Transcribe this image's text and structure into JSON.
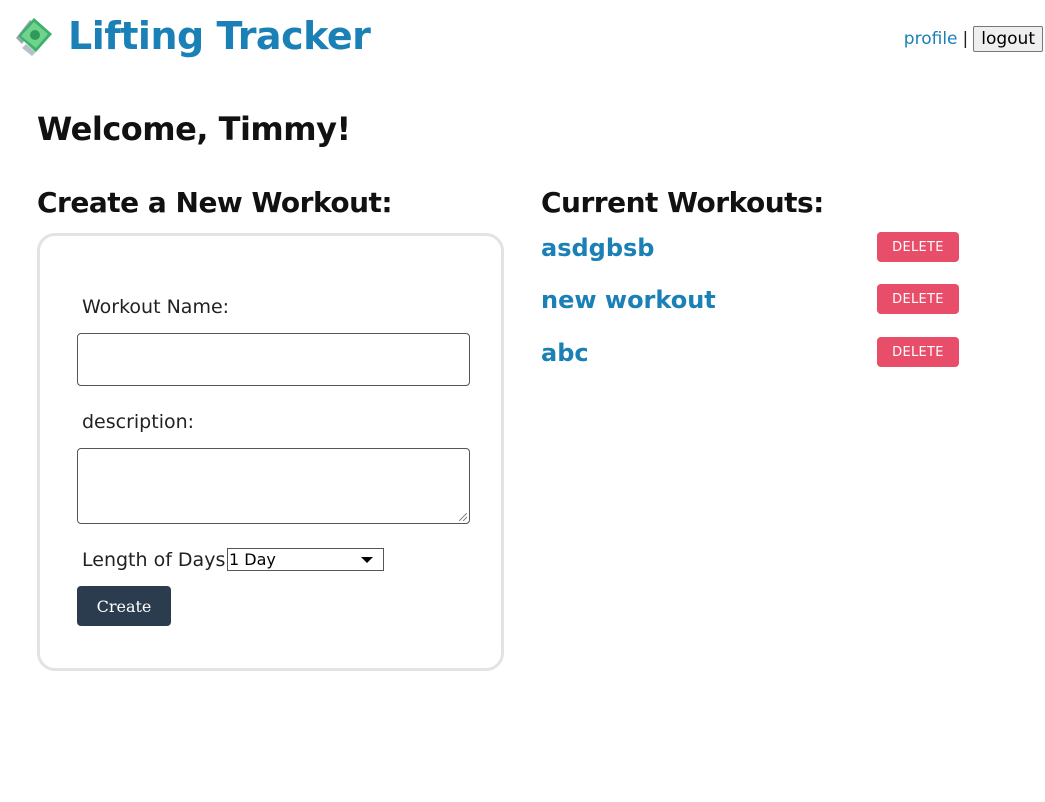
{
  "header": {
    "title": "Lifting Tracker",
    "logo_icon": "dollar-bill-icon",
    "profile_link": "profile",
    "separator": "|",
    "logout_label": "logout"
  },
  "welcome": "Welcome, Timmy!",
  "create_form": {
    "title": "Create a New Workout:",
    "name_label": "Workout Name:",
    "name_value": "",
    "description_label": "description:",
    "description_value": "",
    "days_label": "Length of Days",
    "days_selected": "1 Day",
    "submit_label": "Create"
  },
  "current": {
    "title": "Current Workouts:",
    "workouts": [
      {
        "name": "asdgbsb",
        "delete_label": "DELETE"
      },
      {
        "name": "new workout",
        "delete_label": "DELETE"
      },
      {
        "name": "abc",
        "delete_label": "DELETE"
      }
    ]
  },
  "colors": {
    "brand": "#1a80b6",
    "create_button": "#2b3c4e",
    "delete_button": "#e84e6a",
    "card_border": "#e3e3e3"
  }
}
